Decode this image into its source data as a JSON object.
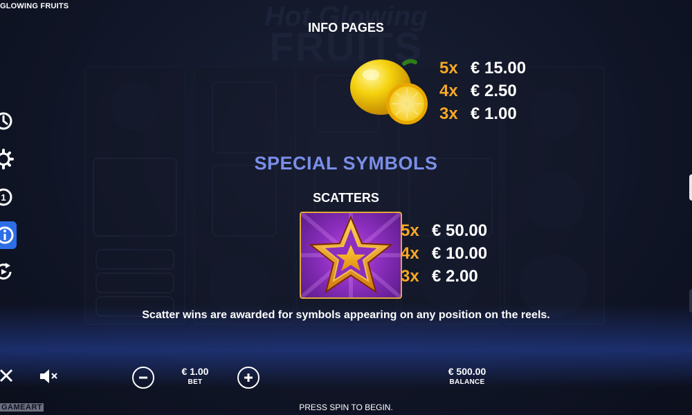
{
  "app": {
    "title": "GLOWING FRUITS"
  },
  "background": {
    "logo_line1": "Hot Glowing",
    "logo_line2": "FRUITS"
  },
  "info": {
    "heading": "INFO PAGES",
    "lemon": {
      "symbol": "lemon-icon",
      "payouts": [
        {
          "mult": "5x",
          "amount": "€ 15.00"
        },
        {
          "mult": "4x",
          "amount": "€ 2.50"
        },
        {
          "mult": "3x",
          "amount": "€ 1.00"
        }
      ]
    },
    "special_heading": "SPECIAL SYMBOLS",
    "scatters": {
      "heading": "SCATTERS",
      "symbol": "star-icon",
      "payouts": [
        {
          "mult": "5x",
          "amount": "€ 50.00"
        },
        {
          "mult": "4x",
          "amount": "€ 10.00"
        },
        {
          "mult": "3x",
          "amount": "€ 2.00"
        }
      ],
      "description": "Scatter wins are awarded for symbols appearing on any position on the reels."
    }
  },
  "sidebar": {
    "items": [
      {
        "icon": "history-icon"
      },
      {
        "icon": "gear-icon"
      },
      {
        "icon": "autoplay-icon"
      },
      {
        "icon": "info-icon",
        "active": true
      },
      {
        "icon": "replay-icon"
      }
    ]
  },
  "bottom": {
    "close_icon": "close-icon",
    "mute_icon": "speaker-muted-icon",
    "bet": {
      "value": "€ 1.00",
      "label": "BET"
    },
    "balance": {
      "value": "€ 500.00",
      "label": "BALANCE"
    },
    "status": "PRESS SPIN TO BEGIN.",
    "brand": "GAMEART"
  },
  "colors": {
    "accent": "#2d6ee6",
    "multiplier": "#f7a824",
    "special": "#7a8ee8"
  }
}
